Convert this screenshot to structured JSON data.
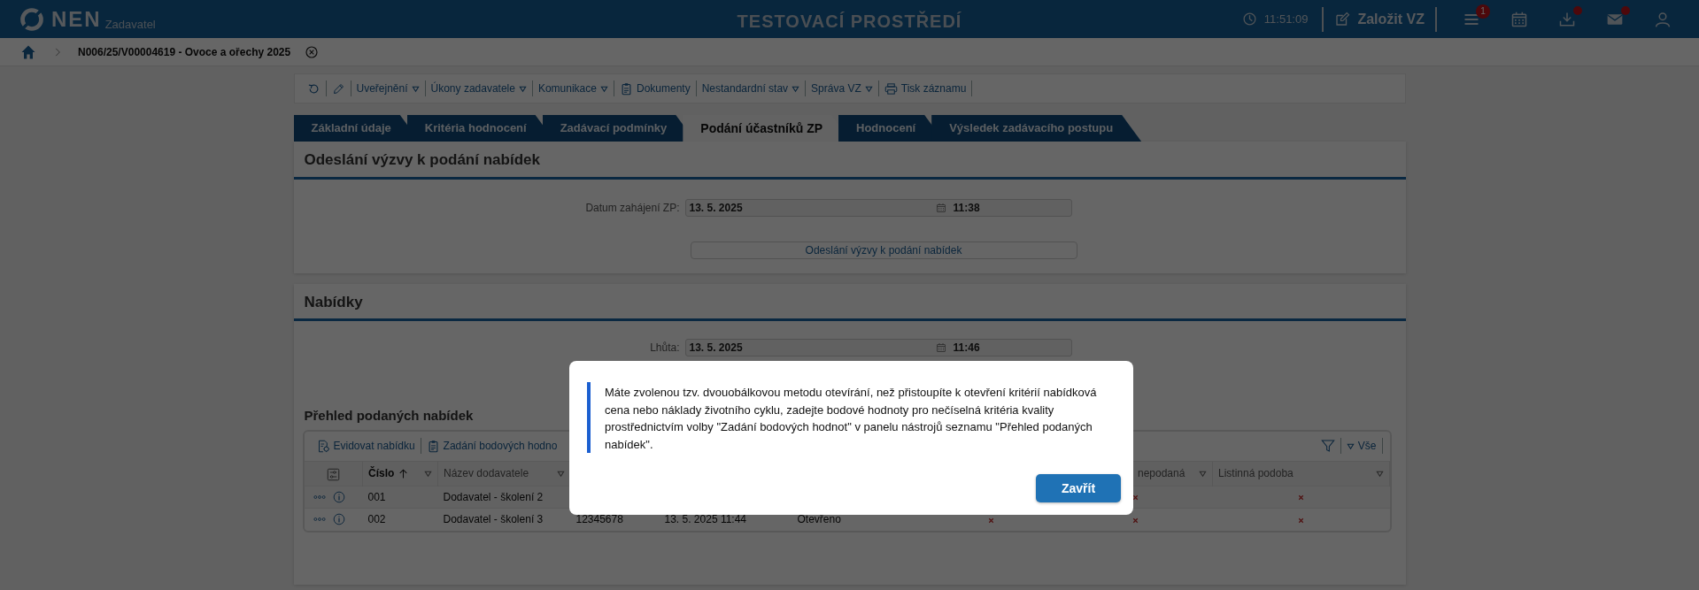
{
  "header": {
    "logo": "NEN",
    "subtitle": "Zadavatel",
    "environment": "TESTOVACÍ PROSTŘEDÍ",
    "time": "11:51:09",
    "create_button": "Založit VZ",
    "icons": [
      {
        "kind": "menu",
        "badge": "1"
      },
      {
        "kind": "calendar"
      },
      {
        "kind": "download",
        "notification": true
      },
      {
        "kind": "mail",
        "notification": true
      },
      {
        "kind": "user"
      }
    ]
  },
  "breadcrumb": {
    "title": "N006/25/V00004619 - Ovoce a ořechy 2025"
  },
  "toolbar": [
    {
      "kind": "refresh"
    },
    {
      "kind": "edit"
    },
    {
      "kind": "dropdown",
      "label": "Uveřejnění"
    },
    {
      "kind": "dropdown",
      "label": "Úkony zadavatele"
    },
    {
      "kind": "dropdown",
      "label": "Komunikace"
    },
    {
      "kind": "documents",
      "label": "Dokumenty"
    },
    {
      "kind": "dropdown",
      "label": "Nestandardní stav"
    },
    {
      "kind": "dropdown",
      "label": "Správa VZ"
    },
    {
      "kind": "print",
      "label": "Tisk záznamu"
    }
  ],
  "tabs": [
    {
      "label": "Základní údaje",
      "selected": false
    },
    {
      "label": "Kritéria hodnocení",
      "selected": false
    },
    {
      "label": "Zadávací podmínky",
      "selected": false
    },
    {
      "label": "Podání účastníků ZP",
      "selected": true
    },
    {
      "label": "Hodnocení",
      "selected": false
    },
    {
      "label": "Výsledek zadávacího postupu",
      "selected": false
    }
  ],
  "invitation": {
    "title": "Odeslání výzvy k podání nabídek",
    "date_label": "Datum zahájení ZP:",
    "date": "13. 5. 2025",
    "time": "11:38",
    "button": "Odeslání výzvy k podání nabídek"
  },
  "offers": {
    "title": "Nabídky",
    "deadline_label": "Lhůta:",
    "date": "13. 5. 2025",
    "time": "11:46"
  },
  "offers_table": {
    "title": "Přehled podaných nabídek",
    "actions": [
      {
        "kind": "register",
        "label": "Evidovat nabídku"
      },
      {
        "kind": "scoring",
        "label": "Zadání bodových hodno"
      }
    ],
    "view": "Vše",
    "columns": [
      {
        "kind": "settings"
      },
      {
        "label": "Číslo",
        "sorted_ascending": true,
        "filter": true
      },
      {
        "label": "Název dodavatele",
        "filter": true
      },
      {},
      {},
      {},
      {},
      {
        "label": "nepodaná",
        "filter": true
      },
      {
        "label": "Listinná podoba",
        "filter": true
      }
    ],
    "rows": [
      {
        "cells": [
          {
            "kind": "actions"
          },
          {
            "text": "001"
          },
          {
            "text": "Dodavatel - školení 2"
          },
          null,
          null,
          null,
          null,
          {
            "kind": "cross"
          },
          {
            "kind": "cross"
          }
        ]
      },
      {
        "cells": [
          {
            "kind": "actions"
          },
          {
            "text": "002"
          },
          {
            "text": "Dodavatel - školení 3"
          },
          {
            "text": "12345678"
          },
          {
            "text": "13. 5. 2025 11:44"
          },
          {
            "text": "Otevřeno"
          },
          {
            "kind": "cross"
          },
          {
            "kind": "cross"
          },
          {
            "kind": "cross"
          }
        ]
      }
    ]
  },
  "dialog": {
    "message": "Máte zvolenou tzv. dvouobálkovou metodu otevírání, než přistoupíte k otevření kritérií nabídková cena nebo náklady životního cyklu, zadejte bodové hodnoty pro nečíselná kritéria kvality prostřednictvím volby \"Zadání bodových hodnot\" v panelu nástrojů seznamu \"Přehled podaných nabídek\".",
    "button": "Zavřít"
  }
}
